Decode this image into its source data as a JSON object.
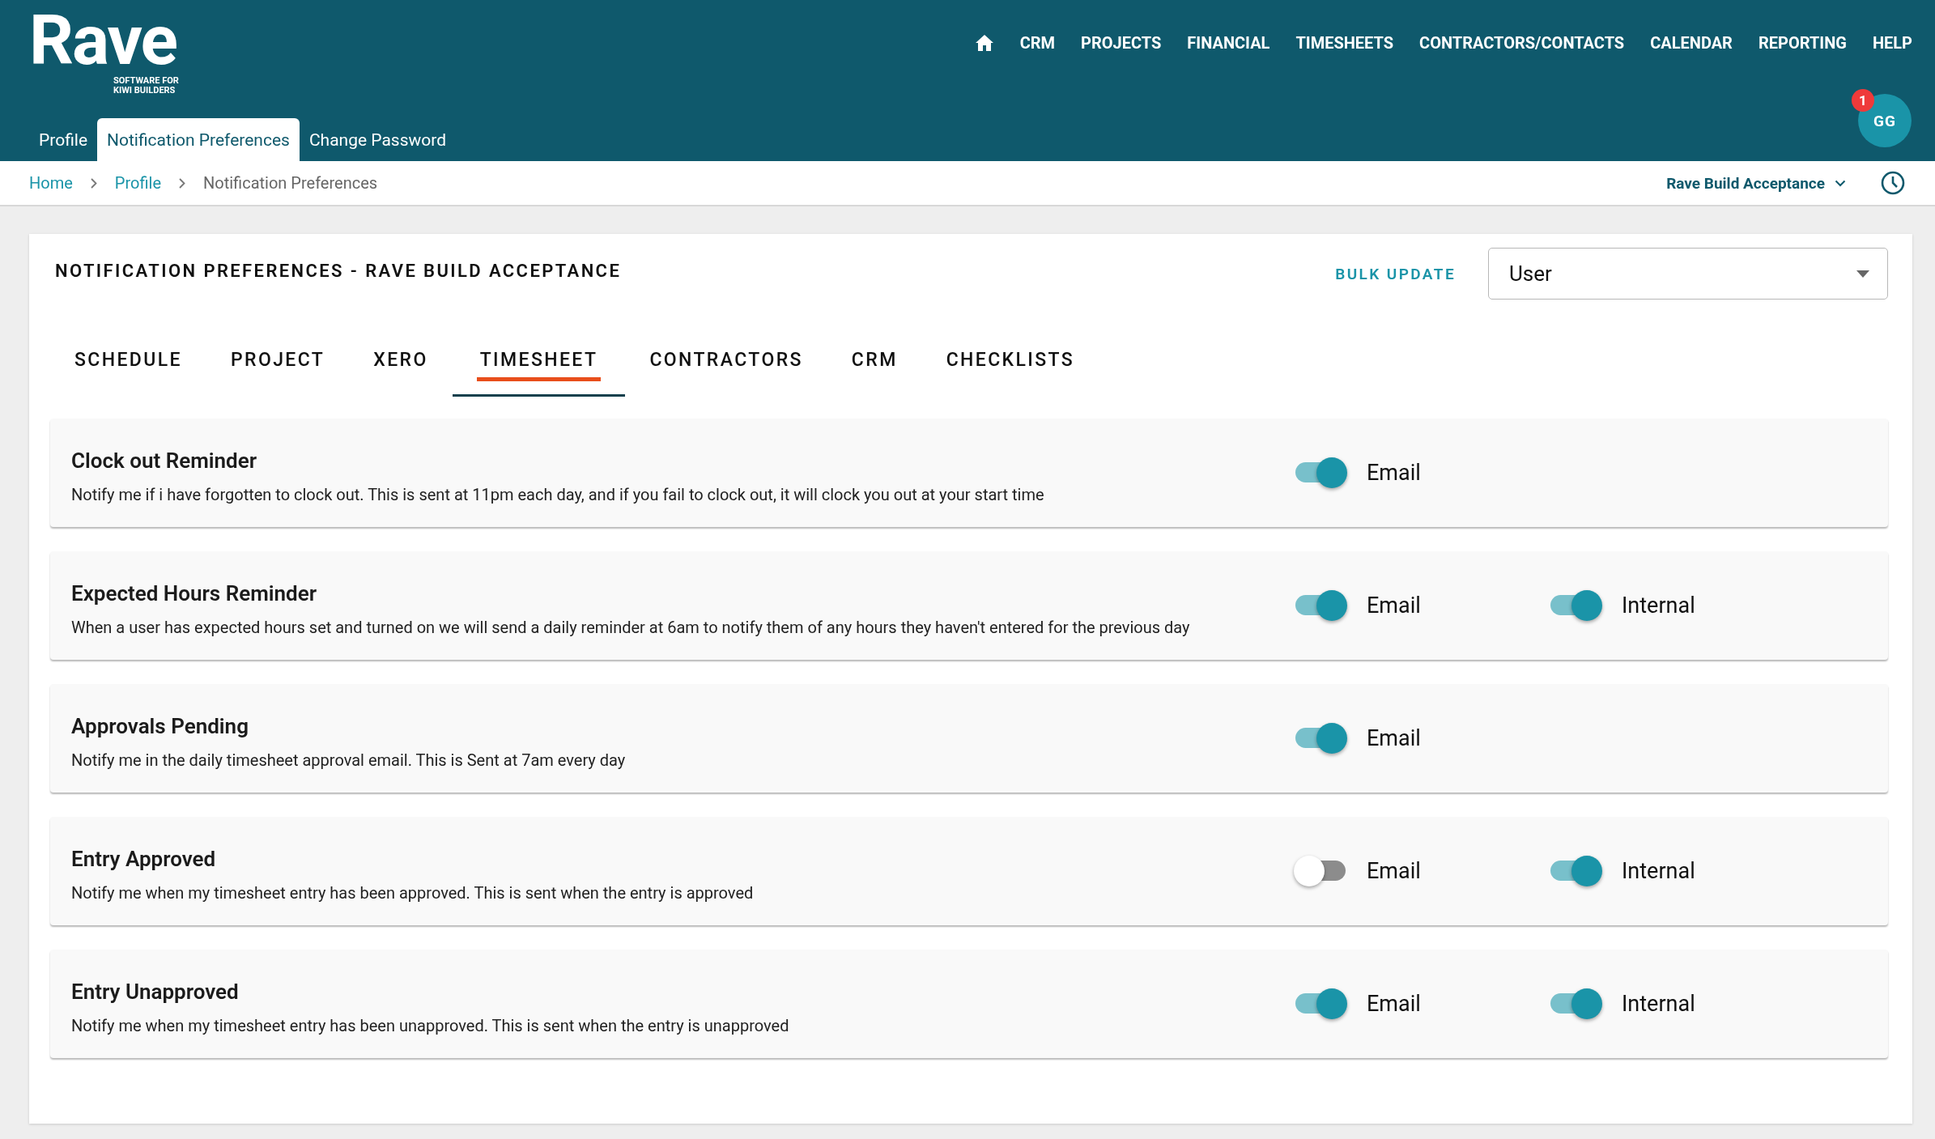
{
  "logo": {
    "name": "Rave",
    "tagline_1": "SOFTWARE FOR",
    "tagline_2": "KIWI BUILDERS"
  },
  "top_nav": [
    "CRM",
    "PROJECTS",
    "FINANCIAL",
    "TIMESHEETS",
    "CONTRACTORS/CONTACTS",
    "CALENDAR",
    "REPORTING",
    "HELP"
  ],
  "notification_badge": "1",
  "avatar": "GG",
  "sub_tabs": [
    {
      "label": "Profile",
      "selected": false
    },
    {
      "label": "Notification Preferences",
      "selected": true
    },
    {
      "label": "Change Password",
      "selected": false
    }
  ],
  "breadcrumbs": [
    "Home",
    "Profile",
    "Notification Preferences"
  ],
  "company_selector": "Rave Build Acceptance",
  "panel": {
    "title": "NOTIFICATION PREFERENCES - RAVE BUILD ACCEPTANCE",
    "bulk_update": "BULK UPDATE",
    "role_select": {
      "value": "User"
    },
    "tabs": [
      {
        "label": "SCHEDULE",
        "selected": false
      },
      {
        "label": "PROJECT",
        "selected": false
      },
      {
        "label": "XERO",
        "selected": false
      },
      {
        "label": "TIMESHEET",
        "selected": true
      },
      {
        "label": "CONTRACTORS",
        "selected": false
      },
      {
        "label": "CRM",
        "selected": false
      },
      {
        "label": "CHECKLISTS",
        "selected": false
      }
    ],
    "rows": [
      {
        "title": "Clock out Reminder",
        "description": "Notify me if i have forgotten to clock out. This is sent at 11pm each day, and if you fail to clock out, it will clock you out at your start time",
        "channels": [
          {
            "label": "Email",
            "on": true
          }
        ]
      },
      {
        "title": "Expected Hours Reminder",
        "description": "When a user has expected hours set and turned on we will send a daily reminder at 6am to notify them of any hours they haven't entered for the previous day",
        "channels": [
          {
            "label": "Email",
            "on": true
          },
          {
            "label": "Internal",
            "on": true
          }
        ]
      },
      {
        "title": "Approvals Pending",
        "description": "Notify me in the daily timesheet approval email. This is Sent at 7am every day",
        "channels": [
          {
            "label": "Email",
            "on": true
          }
        ]
      },
      {
        "title": "Entry Approved",
        "description": "Notify me when my timesheet entry has been approved. This is sent when the entry is approved",
        "channels": [
          {
            "label": "Email",
            "on": false
          },
          {
            "label": "Internal",
            "on": true
          }
        ]
      },
      {
        "title": "Entry Unapproved",
        "description": "Notify me when my timesheet entry has been unapproved. This is sent when the entry is unapproved",
        "channels": [
          {
            "label": "Email",
            "on": true
          },
          {
            "label": "Internal",
            "on": true
          }
        ]
      }
    ]
  }
}
